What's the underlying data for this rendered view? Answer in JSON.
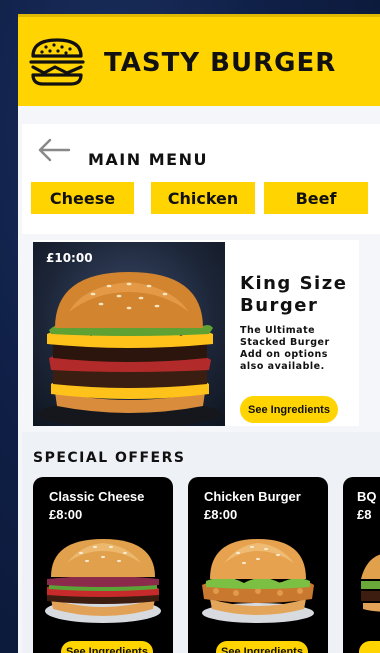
{
  "header": {
    "brand": "TASTY BURGER",
    "logo_icon": "burger-icon"
  },
  "nav": {
    "back_icon": "arrow-left-icon",
    "title": "MAIN MENU"
  },
  "categories": [
    {
      "label": "Cheese"
    },
    {
      "label": "Chicken"
    },
    {
      "label": "Beef"
    }
  ],
  "featured": {
    "price": "£10:00",
    "title": "King Size Burger",
    "description": "The Ultimate Stacked Burger Add on options also available.",
    "cta": "See Ingredients"
  },
  "offers": {
    "title": "SPECIAL OFFERS",
    "items": [
      {
        "name": "Classic Cheese",
        "price": "£8:00",
        "cta": "See Ingredients"
      },
      {
        "name": "Chicken Burger",
        "price": "£8:00",
        "cta": "See Ingredients"
      },
      {
        "name": "BQ",
        "price": "£8",
        "cta": ""
      }
    ]
  },
  "colors": {
    "accent": "#ffd400",
    "background": "#0f1f46",
    "card": "#000000"
  }
}
